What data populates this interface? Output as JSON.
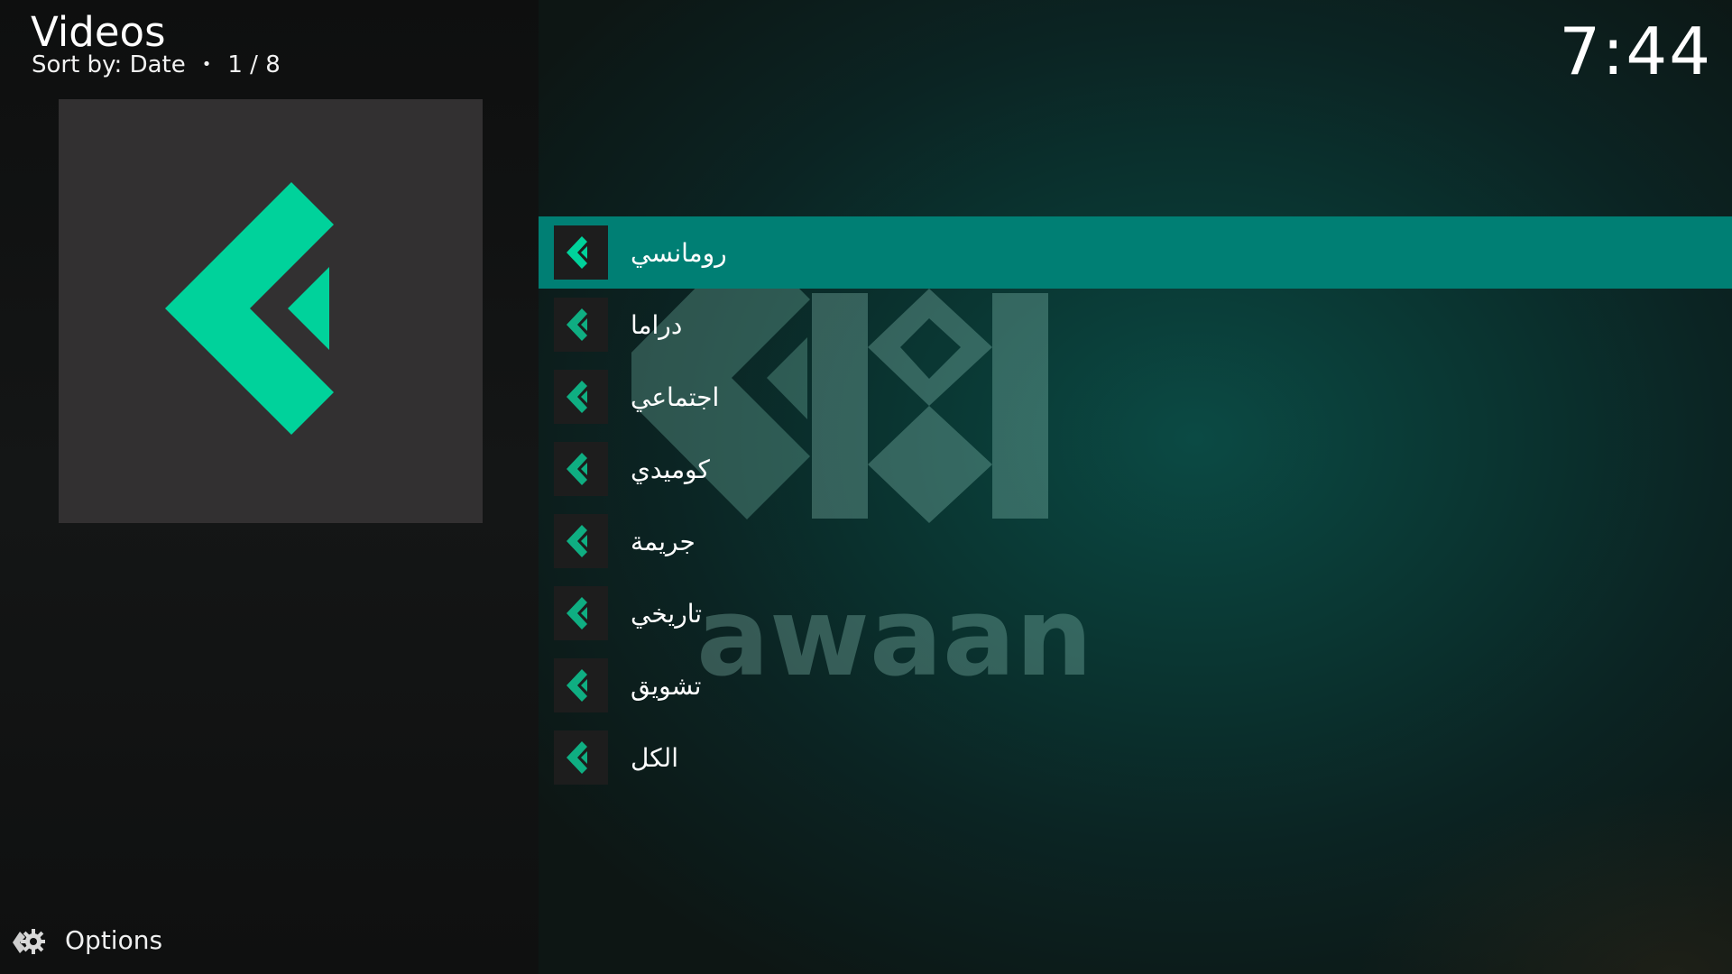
{
  "header": {
    "title": "Videos",
    "sort_label": "Sort by: Date",
    "separator": "•",
    "position": "1 / 8"
  },
  "clock": "7:44",
  "watermark": {
    "text": "awaan",
    "color": "#7fb3a8"
  },
  "thumbnail": {
    "icon": "awaan-chevron-logo",
    "background": "#323031",
    "accent": "#00d29b"
  },
  "list": {
    "focused_color": "#007f74",
    "items": [
      {
        "label": "رومانسي",
        "icon": "awaan-chevron-icon",
        "focused": true
      },
      {
        "label": "دراما",
        "icon": "awaan-chevron-icon",
        "focused": false
      },
      {
        "label": "اجتماعي",
        "icon": "awaan-chevron-icon",
        "focused": false
      },
      {
        "label": "كوميدي",
        "icon": "awaan-chevron-icon",
        "focused": false
      },
      {
        "label": "جريمة",
        "icon": "awaan-chevron-icon",
        "focused": false
      },
      {
        "label": "تاريخي",
        "icon": "awaan-chevron-icon",
        "focused": false
      },
      {
        "label": "تشويق",
        "icon": "awaan-chevron-icon",
        "focused": false
      },
      {
        "label": "الكل",
        "icon": "awaan-chevron-icon",
        "focused": false
      }
    ]
  },
  "options": {
    "label": "Options",
    "icon": "options-gear-icon"
  }
}
